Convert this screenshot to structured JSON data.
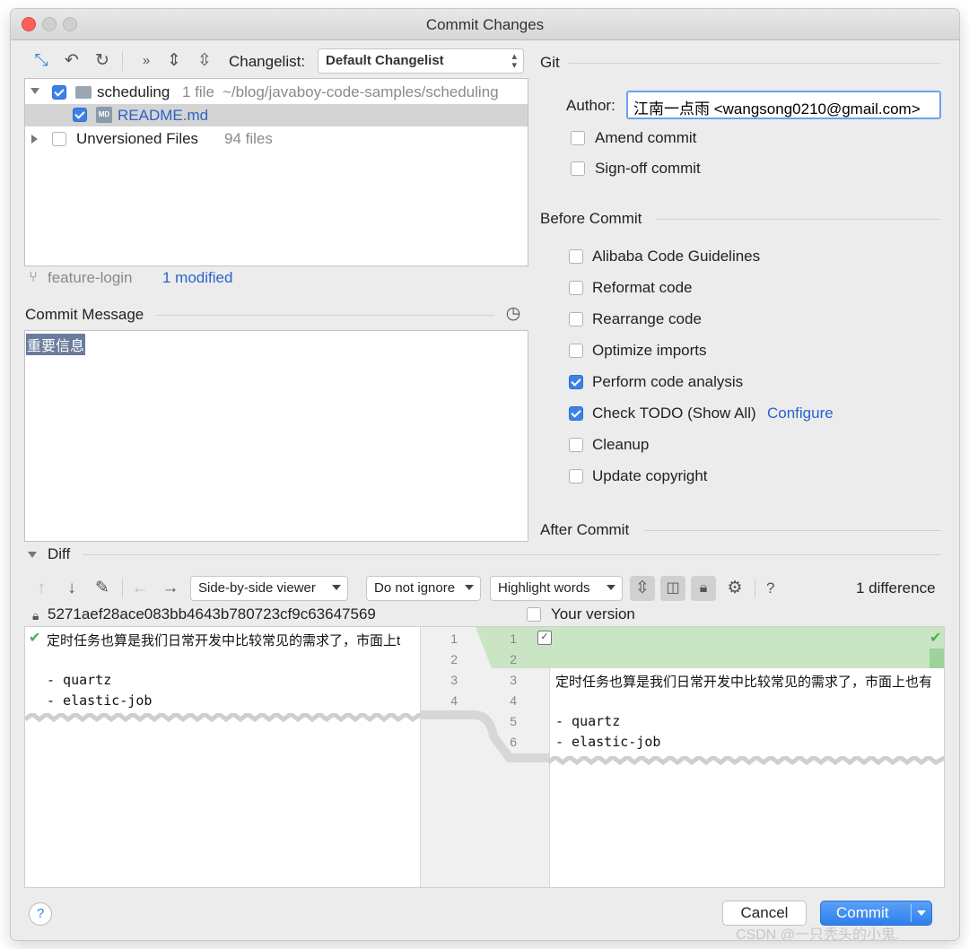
{
  "window": {
    "title": "Commit Changes"
  },
  "changes": {
    "changelist_label": "Changelist:",
    "changelist_value": "Default Changelist",
    "tree": {
      "module_name": "scheduling",
      "module_count": "1 file",
      "module_path": "~/blog/javaboy-code-samples/scheduling",
      "file_icon": "MD",
      "file_name": "README.md",
      "unversioned_label": "Unversioned Files",
      "unversioned_count": "94 files"
    },
    "branch": "feature-login",
    "modified": "1 modified"
  },
  "commit_message": {
    "label": "Commit Message",
    "text": "重要信息"
  },
  "git": {
    "section": "Git",
    "author_label": "Author:",
    "author_value": "江南一点雨 <wangsong0210@gmail.com>",
    "amend": "Amend commit",
    "signoff": "Sign-off commit"
  },
  "before_commit": {
    "section": "Before Commit",
    "items": [
      {
        "label": "Alibaba Code Guidelines",
        "checked": false
      },
      {
        "label": "Reformat code",
        "checked": false
      },
      {
        "label": "Rearrange code",
        "checked": false
      },
      {
        "label": "Optimize imports",
        "checked": false
      },
      {
        "label": "Perform code analysis",
        "checked": true
      },
      {
        "label": "Check TODO (Show All)",
        "checked": true
      },
      {
        "label": "Cleanup",
        "checked": false
      },
      {
        "label": "Update copyright",
        "checked": false
      }
    ],
    "configure": "Configure"
  },
  "after_commit": {
    "section": "After Commit"
  },
  "diff": {
    "label": "Diff",
    "viewer": "Side-by-side viewer",
    "ignore": "Do not ignore",
    "highlight": "Highlight words",
    "help": "?",
    "count": "1 difference",
    "left_title": "5271aef28ace083bb4643b780723cf9c63647569",
    "right_title": "Your version",
    "left_lines": [
      "定时任务也算是我们日常开发中比较常见的需求了，市面上t",
      "",
      "- quartz",
      "- elastic-job"
    ],
    "left_nums": [
      "1",
      "2",
      "3",
      "4"
    ],
    "right_nums": [
      "1",
      "2",
      "3",
      "4",
      "5",
      "6"
    ],
    "right_lines": [
      "",
      "",
      "定时任务也算是我们日常开发中比较常见的需求了，市面上也有",
      "",
      "- quartz",
      "- elastic-job"
    ]
  },
  "buttons": {
    "help": "?",
    "cancel": "Cancel",
    "commit": "Commit"
  },
  "watermark": "CSDN @一只秃头的小鬼."
}
